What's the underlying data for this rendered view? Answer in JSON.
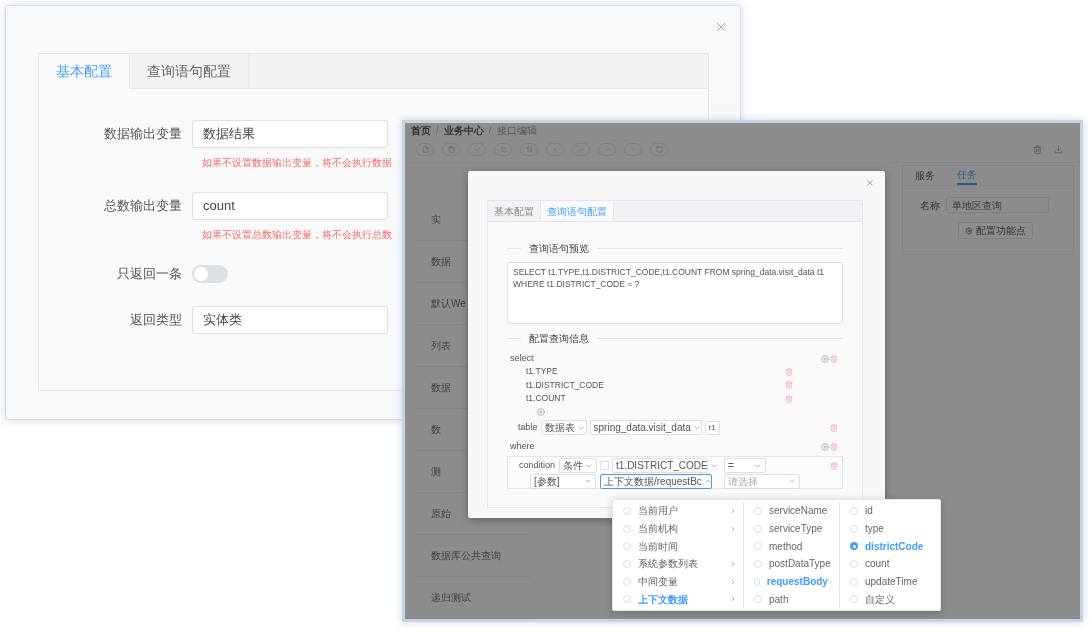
{
  "back_window": {
    "tabs": [
      {
        "label": "基本配置",
        "selected": true
      },
      {
        "label": "查询语句配置",
        "selected": false
      }
    ],
    "fields": [
      {
        "kind": "input",
        "label": "数据输出变量",
        "value": "数据结果",
        "hint": "如果不设置数据输出变量，将不会执行数据"
      },
      {
        "kind": "input",
        "label": "总数输出变量",
        "value": "count",
        "hint": "如果不设置总数输出变量，将不会执行总数"
      },
      {
        "kind": "switch",
        "label": "只返回一条",
        "on": false
      },
      {
        "kind": "select",
        "label": "返回类型",
        "value": "实体类"
      }
    ]
  },
  "front_window": {
    "breadcrumb": [
      "首页",
      "业务中心",
      "接口编辑"
    ],
    "breadcrumb_separator": "/",
    "sidebar_items": [
      "实",
      "数据",
      "默认We",
      "列表",
      "数据",
      "数",
      "测",
      "原始",
      "数据库公共查询",
      "递归测试"
    ],
    "side_panel": {
      "tabs": [
        {
          "label": "服务",
          "selected": false
        },
        {
          "label": "任务",
          "selected": true
        }
      ],
      "name_label": "名称",
      "name_value": "单地区查询",
      "button": "配置功能点"
    },
    "dialog": {
      "tabs": [
        {
          "label": "基本配置",
          "selected": false
        },
        {
          "label": "查询语句配置",
          "selected": true
        }
      ],
      "preview_title": "查询语句预览",
      "sql": "SELECT t1.TYPE,t1.DISTRICT_CODE,t1.COUNT FROM spring_data.visit_data t1 WHERE t1.DISTRICT_CODE = ?",
      "config_title": "配置查询信息",
      "select": {
        "label": "select",
        "columns": [
          "t1.TYPE",
          "t1.DISTRICT_CODE",
          "t1.COUNT"
        ]
      },
      "table": {
        "label": "table",
        "source_type": "数据表",
        "name": "spring_data.visit_data",
        "alias": "t1"
      },
      "where": {
        "label": "where",
        "condition": {
          "label": "condition",
          "type": "条件",
          "negated": false,
          "column": "t1.DISTRICT_CODE",
          "operator": "=",
          "value_type": "[参数]",
          "value": "上下文数据/requestBc",
          "placeholder": "请选择",
          "expanded": true
        }
      }
    },
    "cascader": {
      "columns": [
        [
          {
            "label": "当前用户",
            "selected": false,
            "checked": false,
            "expandable": true
          },
          {
            "label": "当前机构",
            "selected": false,
            "checked": false,
            "expandable": true
          },
          {
            "label": "当前时间",
            "selected": false,
            "checked": false,
            "expandable": false
          },
          {
            "label": "系统参数列表",
            "selected": false,
            "checked": false,
            "expandable": true
          },
          {
            "label": "中间变量",
            "selected": false,
            "checked": false,
            "expandable": true
          },
          {
            "label": "上下文数据",
            "selected": true,
            "checked": false,
            "expandable": true
          }
        ],
        [
          {
            "label": "serviceName",
            "selected": false,
            "checked": false,
            "expandable": false
          },
          {
            "label": "serviceType",
            "selected": false,
            "checked": false,
            "expandable": false
          },
          {
            "label": "method",
            "selected": false,
            "checked": false,
            "expandable": false
          },
          {
            "label": "postDataType",
            "selected": false,
            "checked": false,
            "expandable": false
          },
          {
            "label": "requestBody",
            "selected": true,
            "checked": false,
            "expandable": true
          },
          {
            "label": "path",
            "selected": false,
            "checked": false,
            "expandable": false
          }
        ],
        [
          {
            "label": "id",
            "selected": false,
            "checked": false,
            "expandable": false
          },
          {
            "label": "type",
            "selected": false,
            "checked": false,
            "expandable": false
          },
          {
            "label": "districtCode",
            "selected": true,
            "checked": true,
            "expandable": false
          },
          {
            "label": "count",
            "selected": false,
            "checked": false,
            "expandable": false
          },
          {
            "label": "updateTime",
            "selected": false,
            "checked": false,
            "expandable": false
          },
          {
            "label": "自定义",
            "selected": false,
            "checked": false,
            "expandable": false
          }
        ]
      ]
    }
  }
}
